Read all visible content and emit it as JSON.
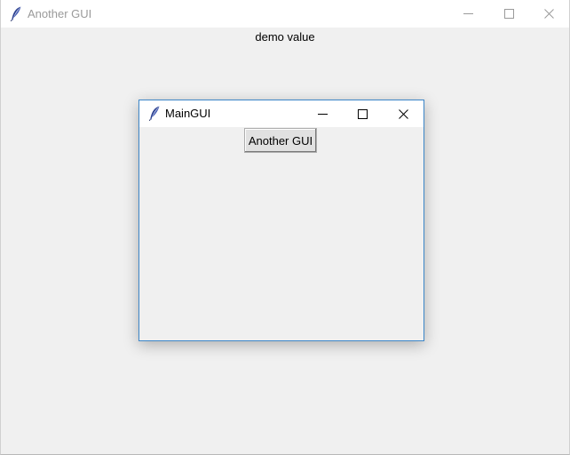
{
  "outer_window": {
    "title": "Another GUI",
    "content_label": "demo value",
    "icon": "feather-icon",
    "controls": [
      "minimize-icon",
      "maximize-icon",
      "close-icon"
    ]
  },
  "inner_window": {
    "title": "MainGUI",
    "icon": "feather-icon",
    "controls": [
      "minimize-icon",
      "maximize-icon",
      "close-icon"
    ],
    "button_label": "Another GUI"
  },
  "colors": {
    "window_bg": "#f0f0f0",
    "titlebar_bg": "#ffffff",
    "inactive_title_text": "#9a9a9a",
    "active_border": "#3c86c8"
  }
}
